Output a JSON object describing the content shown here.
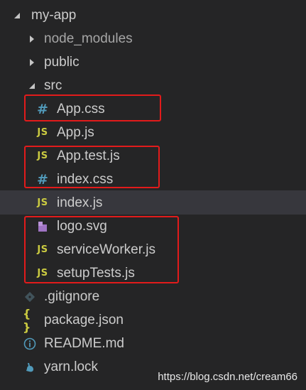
{
  "explorer": {
    "root": {
      "label": "my-app",
      "icon": "chevron-down-icon",
      "expanded": true
    },
    "node_modules": {
      "label": "node_modules",
      "icon": "chevron-right-icon",
      "expanded": false
    },
    "public": {
      "label": "public",
      "icon": "chevron-right-icon",
      "expanded": false
    },
    "src": {
      "label": "src",
      "icon": "chevron-down-icon",
      "expanded": true
    },
    "src_files": {
      "app_css": {
        "label": "App.css",
        "icon": "css-file-icon",
        "icon_text": "#"
      },
      "app_js": {
        "label": "App.js",
        "icon": "js-file-icon",
        "icon_text": "JS"
      },
      "app_test_js": {
        "label": "App.test.js",
        "icon": "js-file-icon",
        "icon_text": "JS"
      },
      "index_css": {
        "label": "index.css",
        "icon": "css-file-icon",
        "icon_text": "#"
      },
      "index_js": {
        "label": "index.js",
        "icon": "js-file-icon",
        "icon_text": "JS",
        "selected": true
      },
      "logo_svg": {
        "label": "logo.svg",
        "icon": "svg-file-icon"
      },
      "service_worker_js": {
        "label": "serviceWorker.js",
        "icon": "js-file-icon",
        "icon_text": "JS"
      },
      "setup_tests_js": {
        "label": "setupTests.js",
        "icon": "js-file-icon",
        "icon_text": "JS"
      }
    },
    "root_files": {
      "gitignore": {
        "label": ".gitignore",
        "icon": "git-icon"
      },
      "package_json": {
        "label": "package.json",
        "icon": "json-file-icon",
        "icon_text": "{ }"
      },
      "readme": {
        "label": "README.md",
        "icon": "info-icon"
      },
      "yarn_lock": {
        "label": "yarn.lock",
        "icon": "yarn-icon"
      }
    }
  },
  "highlights": [
    "App.css",
    "App.test.js + index.css",
    "logo.svg + serviceWorker.js + setupTests.js"
  ],
  "colors": {
    "background": "#252526",
    "selected_row": "#37373d",
    "text": "#cccccc",
    "js_icon": "#cbcb41",
    "css_icon": "#519aba",
    "svg_icon": "#a074c4",
    "highlight_box": "#e21b1b"
  },
  "watermark": "https://blog.csdn.net/cream66"
}
